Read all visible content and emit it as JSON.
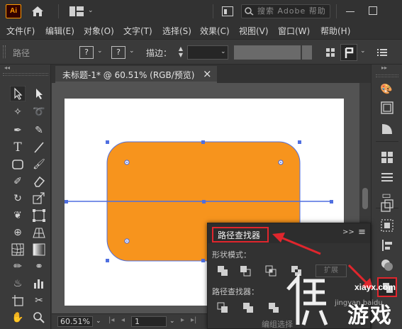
{
  "app": {
    "logo": "Ai",
    "search_placeholder": "搜索 Adobe 帮助"
  },
  "menu": [
    "文件(F)",
    "编辑(E)",
    "对象(O)",
    "文字(T)",
    "选择(S)",
    "效果(C)",
    "视图(V)",
    "窗口(W)",
    "帮助(H)"
  ],
  "control": {
    "path_label": "路径",
    "fill_glyph": "?",
    "stroke_glyph": "?",
    "stroke_label": "描边："
  },
  "document": {
    "tab_title": "未标题-1* @ 60.51% (RGB/预览)",
    "close": "×",
    "zoom": "60.51%",
    "artboard_number": "1",
    "status_text": "编组选择"
  },
  "pathfinder": {
    "title": "路径查找器",
    "shape_modes_label": "形状模式：",
    "pathfinders_label": "路径查找器：",
    "expand_label": "扩展",
    "menu_glyph": "≡",
    "collapse_glyph": ">>"
  },
  "watermark": {
    "domain": "xiayx.com",
    "sub": "jingyan.baidu",
    "brand": "游戏"
  },
  "colors": {
    "shape_fill": "#f7941d",
    "selection": "#4f6fe0",
    "highlight": "#e0262d",
    "ai_brand": "#ff9a00"
  }
}
